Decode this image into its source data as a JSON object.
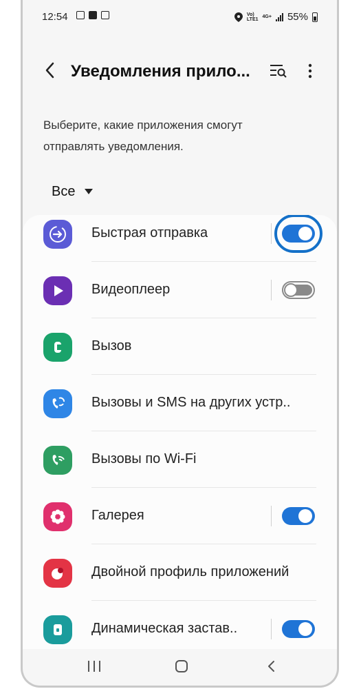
{
  "status_bar": {
    "time": "12:54",
    "network_top": "Vo)",
    "network_bottom": "LTE1",
    "data_label": "4G+",
    "battery": "55%"
  },
  "header": {
    "title": "Уведомления прило...",
    "back_icon": "chevron-left-icon",
    "search_icon": "list-search-icon",
    "more_icon": "more-vertical-icon"
  },
  "description": "Выберите, какие приложения смогут отправлять уведомления.",
  "filter": {
    "label": "Все"
  },
  "accent_color": "#1f74d6",
  "apps": [
    {
      "label": "Быстрая отправка",
      "icon": "quick-share-icon",
      "color": "#5b5bd6",
      "toggle": true,
      "highlighted": true
    },
    {
      "label": "Видеоплеер",
      "icon": "play-icon",
      "color": "#6b2fb3",
      "toggle": false
    },
    {
      "label": "Вызов",
      "icon": "phone-icon",
      "color": "#1aa36b"
    },
    {
      "label": "Вызовы и SMS на других устр..",
      "icon": "call-sync-icon",
      "color": "#2f86e6"
    },
    {
      "label": "Вызовы по Wi-Fi",
      "icon": "wifi-call-icon",
      "color": "#2e9e62"
    },
    {
      "label": "Галерея",
      "icon": "flower-icon",
      "color": "#e0306d",
      "toggle": true
    },
    {
      "label": "Двойной профиль приложений",
      "icon": "dual-profile-icon",
      "color": "#e33445"
    },
    {
      "label": "Динамическая застав..",
      "icon": "lock-icon",
      "color": "#1a9c9c",
      "toggle": true
    }
  ]
}
